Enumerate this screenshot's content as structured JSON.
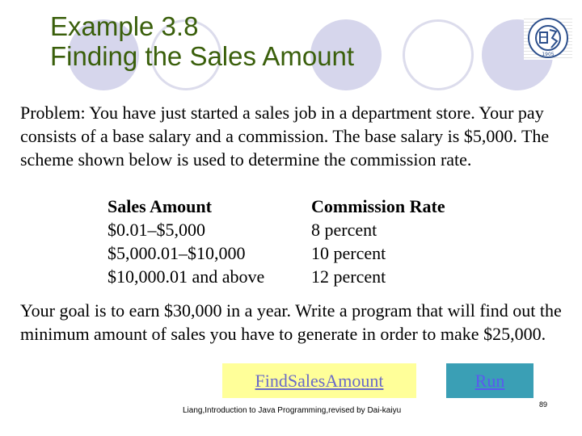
{
  "slide": {
    "title_line1": "Example 3.8",
    "title_line2": "Finding the Sales Amount",
    "problem_text": "Problem: You have just started a sales job in a department store. Your pay consists of a base salary and a commission. The base salary is $5,000. The scheme shown below is used to determine the commission rate.",
    "table": {
      "headers": [
        "Sales Amount",
        "Commission Rate"
      ],
      "rows": [
        [
          "$0.01–$5,000",
          "8 percent"
        ],
        [
          "$5,000.01–$10,000",
          "10 percent"
        ],
        [
          "$10,000.01 and above",
          "12 percent"
        ]
      ]
    },
    "goal_text": "Your goal is to earn $30,000 in a year. Write a program that will find out the minimum amount of sales you have to generate in order to make $25,000.",
    "buttons": {
      "find_label": "FindSalesAmount",
      "run_label": "Run"
    },
    "footer": "Liang,Introduction to Java Programming,revised by Dai-kaiyu",
    "page_number": "89",
    "logo": {
      "icon": "university-seal-icon",
      "year": "1905"
    }
  },
  "colors": {
    "title": "#3a5f0b",
    "find_bg": "#ffff99",
    "run_bg": "#3a9fb5",
    "link": "#6a6ac8",
    "decoration": "#d6d6ec"
  }
}
